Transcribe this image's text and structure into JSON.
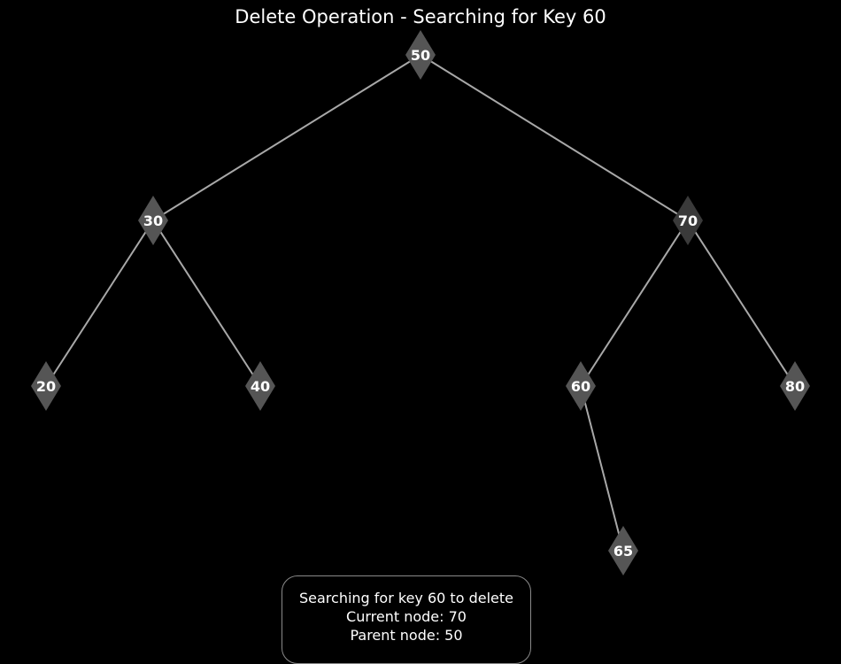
{
  "title": "Delete Operation - Searching for Key 60",
  "colors": {
    "background": "#000000",
    "edge": "#a8a8a8",
    "node_default": "#555555",
    "node_current": "#3a3a3a",
    "label": "#ffffff",
    "info_border": "#8a8a8a"
  },
  "tree": {
    "nodes": [
      {
        "id": "50",
        "label": "50",
        "state": "visited"
      },
      {
        "id": "30",
        "label": "30",
        "state": "default"
      },
      {
        "id": "70",
        "label": "70",
        "state": "current"
      },
      {
        "id": "20",
        "label": "20",
        "state": "default"
      },
      {
        "id": "40",
        "label": "40",
        "state": "default"
      },
      {
        "id": "60",
        "label": "60",
        "state": "default"
      },
      {
        "id": "80",
        "label": "80",
        "state": "default"
      },
      {
        "id": "65",
        "label": "65",
        "state": "default"
      }
    ],
    "edges": [
      {
        "from": "50",
        "to": "30"
      },
      {
        "from": "50",
        "to": "70"
      },
      {
        "from": "30",
        "to": "20"
      },
      {
        "from": "30",
        "to": "40"
      },
      {
        "from": "70",
        "to": "60"
      },
      {
        "from": "70",
        "to": "80"
      },
      {
        "from": "60",
        "to": "65"
      }
    ]
  },
  "info": {
    "line1": "Searching for key 60 to delete",
    "line2": "Current node: 70",
    "line3": "Parent node: 50"
  }
}
